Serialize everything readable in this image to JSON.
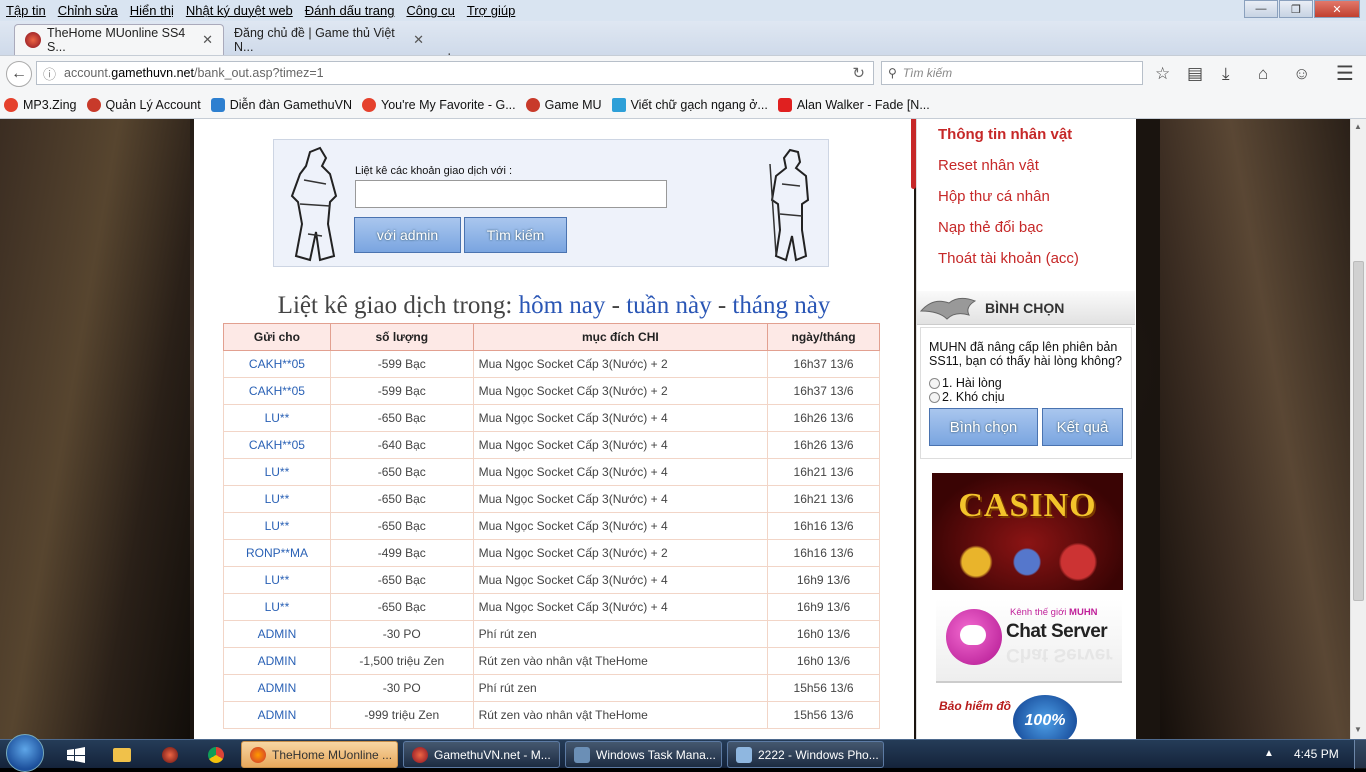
{
  "menu_bar": {
    "items": [
      "Tập tin",
      "Chỉnh sửa",
      "Hiển thị",
      "Nhật ký duyệt web",
      "Đánh dấu trang",
      "Công cụ",
      "Trợ giúp"
    ]
  },
  "tabs": [
    {
      "label": "TheHome MUonline SS4 S...",
      "active": true
    },
    {
      "label": "Đăng chủ đề | Game thủ Việt N...",
      "active": false
    }
  ],
  "address_bar": {
    "url_prefix": "account.",
    "url_host": "gamethuvn.net",
    "url_path": "/bank_out.asp?timez=1"
  },
  "search_bar": {
    "placeholder": "Tìm kiếm"
  },
  "bookmarks": [
    {
      "label": "MP3.Zing",
      "icon": "chrome-icon",
      "color": "#e5412d"
    },
    {
      "label": "Quản Lý Account",
      "icon": "mu-icon",
      "color": "#c83a2a"
    },
    {
      "label": "Diễn đàn GamethuVN",
      "icon": "forum-icon",
      "color": "#2d7fd0"
    },
    {
      "label": "You're My Favorite - G...",
      "icon": "chrome-icon",
      "color": "#e5412d"
    },
    {
      "label": "Game MU",
      "icon": "mu-icon",
      "color": "#c83a2a"
    },
    {
      "label": "Viết chữ gạch ngang ở...",
      "icon": "page-icon",
      "color": "#2d9fd8"
    },
    {
      "label": "Alan Walker - Fade [N...",
      "icon": "youtube-icon",
      "color": "#e02020"
    }
  ],
  "search_panel": {
    "label": "Liệt kê các khoản giao dịch với :",
    "input_value": "",
    "btn_admin": "với admin",
    "btn_search": "Tìm kiếm"
  },
  "list_title": {
    "prefix": "Liệt kê giao dịch trong:",
    "today": "hôm nay",
    "sep1": " - ",
    "week": "tuần này",
    "sep2": " - ",
    "month": "tháng này"
  },
  "table": {
    "headers": [
      "Gửi cho",
      "số lượng",
      "mục đích CHI",
      "ngày/tháng"
    ],
    "rows": [
      [
        "CAKH**05",
        "-599  Bạc",
        "Mua Ngọc Socket Cấp 3(Nước) + 2",
        "16h37 13/6"
      ],
      [
        "CAKH**05",
        "-599  Bạc",
        "Mua Ngọc Socket Cấp 3(Nước) + 2",
        "16h37 13/6"
      ],
      [
        "LU**",
        "-650  Bạc",
        "Mua Ngọc Socket Cấp 3(Nước) + 4",
        "16h26 13/6"
      ],
      [
        "CAKH**05",
        "-640  Bạc",
        "Mua Ngọc Socket Cấp 3(Nước) + 4",
        "16h26 13/6"
      ],
      [
        "LU**",
        "-650  Bạc",
        "Mua Ngọc Socket Cấp 3(Nước) + 4",
        "16h21 13/6"
      ],
      [
        "LU**",
        "-650  Bạc",
        "Mua Ngọc Socket Cấp 3(Nước) + 4",
        "16h21 13/6"
      ],
      [
        "LU**",
        "-650  Bạc",
        "Mua Ngọc Socket Cấp 3(Nước) + 4",
        "16h16 13/6"
      ],
      [
        "RONP**MA",
        "-499  Bạc",
        "Mua Ngọc Socket Cấp 3(Nước) + 2",
        "16h16 13/6"
      ],
      [
        "LU**",
        "-650  Bạc",
        "Mua Ngọc Socket Cấp 3(Nước) + 4",
        "16h9 13/6"
      ],
      [
        "LU**",
        "-650  Bạc",
        "Mua Ngọc Socket Cấp 3(Nước) + 4",
        "16h9 13/6"
      ],
      [
        "ADMIN",
        "-30  PO",
        "Phí rút zen",
        "16h0 13/6"
      ],
      [
        "ADMIN",
        "-1,500  triệu Zen",
        "Rút zen vào nhân vật TheHome",
        "16h0 13/6"
      ],
      [
        "ADMIN",
        "-30  PO",
        "Phí rút zen",
        "15h56 13/6"
      ],
      [
        "ADMIN",
        "-999  triệu Zen",
        "Rút zen vào nhân vật TheHome",
        "15h56 13/6"
      ]
    ]
  },
  "sidebar": {
    "menu": [
      {
        "label": "Thông tin nhân vật",
        "bold": true
      },
      {
        "label": "Reset nhân vật",
        "bold": false
      },
      {
        "label": "Hộp thư cá nhân",
        "bold": false
      },
      {
        "label": "Nạp thẻ đổi bạc",
        "bold": false
      },
      {
        "label": "Thoát tài khoản (acc)",
        "bold": false
      }
    ],
    "poll": {
      "title": "BÌNH CHỌN",
      "question": "MUHN đã nâng cấp lên phiên bản SS11, bạn có thấy hài lòng không?",
      "options": [
        "1. Hài lòng",
        "2. Khó chịu"
      ],
      "vote_label": "Bình chọn",
      "result_label": "Kết quả"
    },
    "casino_text": "CASINO",
    "chat_kicker_prefix": "Kênh thế giới ",
    "chat_kicker_brand": "MUHN",
    "chat_title": "Chat Server",
    "insurance_text": "Bảo hiểm đồ",
    "insurance_badge": "100%"
  },
  "taskbar": {
    "buttons": [
      {
        "label": "TheHome MUonline ...",
        "active": true
      },
      {
        "label": "GamethuVN.net - M...",
        "active": false
      },
      {
        "label": "Windows Task Mana...",
        "active": false
      },
      {
        "label": "2222 - Windows Pho...",
        "active": false
      }
    ],
    "clock": "4:45 PM"
  }
}
